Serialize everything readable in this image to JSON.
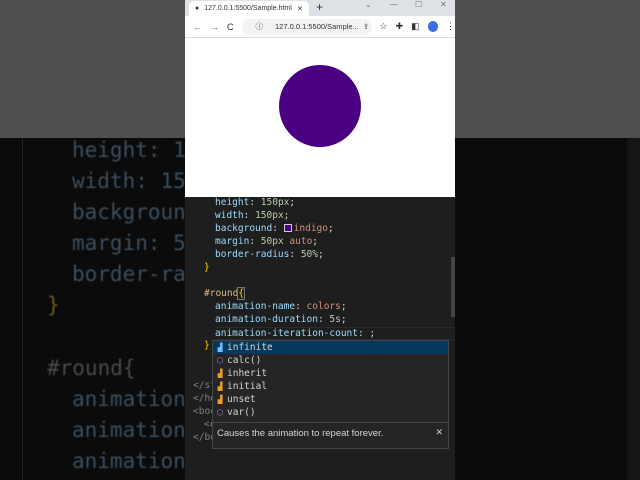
{
  "browser": {
    "tab_title": "127.0.0.1:5500/Sample.html",
    "url": "127.0.0.1:5500/Sample...",
    "circle_color": "#4b0082"
  },
  "background_code": [
    "height: 1",
    "width: 15",
    "backgroun",
    "margin: 5",
    "border-ra",
    "}",
    "#round{",
    "animation",
    "animation",
    "animation"
  ],
  "editor": {
    "lines": [
      {
        "prop": "height",
        "val": "150px"
      },
      {
        "prop": "width",
        "val": "150px"
      },
      {
        "prop": "background",
        "val": "indigo"
      },
      {
        "prop": "margin",
        "val": "50px",
        "val2": "auto"
      },
      {
        "prop": "border-radius",
        "val": "50%"
      }
    ],
    "close_brace": "}",
    "selector": "#round",
    "open_brace": "{",
    "rule_lines": [
      {
        "prop": "animation-name",
        "val": "colors"
      },
      {
        "prop": "animation-duration",
        "val": "5s"
      },
      {
        "prop": "animation-iteration-count",
        "val": ";"
      }
    ],
    "tag_fragments": [
      "</st",
      "</he",
      "<boc",
      "<c",
      "</bo"
    ]
  },
  "suggest": {
    "items": [
      {
        "label": "infinite",
        "icon": "enum-value-icon"
      },
      {
        "label": "calc()",
        "icon": "function-icon"
      },
      {
        "label": "inherit",
        "icon": "enum-value-icon"
      },
      {
        "label": "initial",
        "icon": "enum-value-icon"
      },
      {
        "label": "unset",
        "icon": "enum-value-icon"
      },
      {
        "label": "var()",
        "icon": "function-icon"
      }
    ],
    "detail": "Causes the animation to repeat forever."
  }
}
